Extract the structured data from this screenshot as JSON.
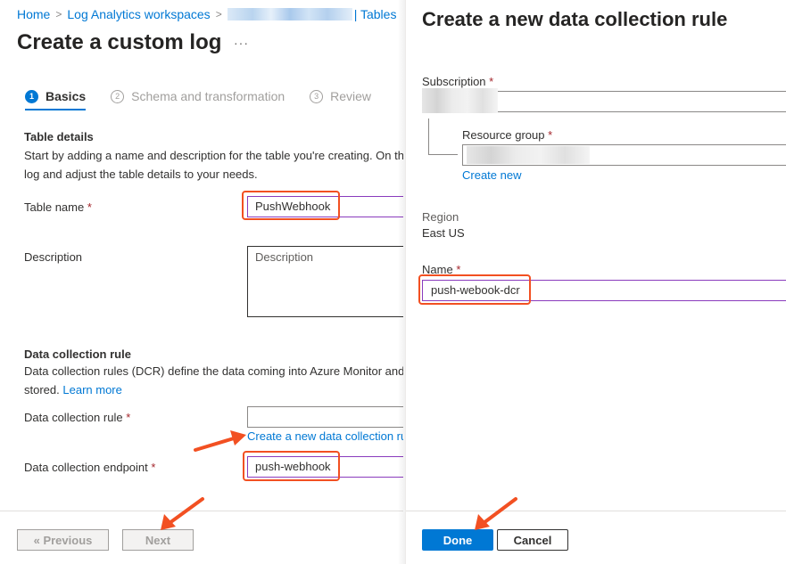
{
  "breadcrumb": {
    "items": [
      "Home",
      "Log Analytics workspaces",
      "| Tables"
    ]
  },
  "left": {
    "title": "Create a custom log",
    "more_label": "···",
    "steps": [
      {
        "num": "1",
        "label": "Basics",
        "active": true
      },
      {
        "num": "2",
        "label": "Schema and transformation",
        "active": false
      },
      {
        "num": "3",
        "label": "Review",
        "active": false
      }
    ],
    "table_details": {
      "title": "Table details",
      "desc_line1": "Start by adding a name and description for the table you're creating. On th",
      "desc_line2": "log and adjust the table details to your needs."
    },
    "table_name": {
      "label": "Table name",
      "required": "*",
      "value": "PushWebhook"
    },
    "description": {
      "label": "Description",
      "placeholder": "Description"
    },
    "dcr_section": {
      "title": "Data collection rule",
      "desc_line1": "Data collection rules (DCR) define the data coming into Azure Monitor and",
      "desc_line2": "stored.",
      "learn_more": "Learn more"
    },
    "dcr_field": {
      "label": "Data collection rule",
      "required": "*",
      "value": "",
      "create_link": "Create a new data collection ru"
    },
    "dce_field": {
      "label": "Data collection endpoint",
      "required": "*",
      "value": "push-webhook"
    },
    "buttons": {
      "previous": "« Previous",
      "next": "Next"
    }
  },
  "right": {
    "title": "Create a new data collection rule",
    "subscription": {
      "label": "Subscription",
      "required": "*"
    },
    "resource_group": {
      "label": "Resource group",
      "required": "*",
      "create_new": "Create new"
    },
    "region": {
      "label": "Region",
      "value": "East US"
    },
    "name": {
      "label": "Name",
      "required": "*",
      "value": "push-webook-dcr"
    },
    "buttons": {
      "done": "Done",
      "cancel": "Cancel"
    }
  },
  "colors": {
    "accent": "#0078d4",
    "annotation": "#f25022",
    "focus_border": "#8a3bbd",
    "required": "#a4262c"
  }
}
